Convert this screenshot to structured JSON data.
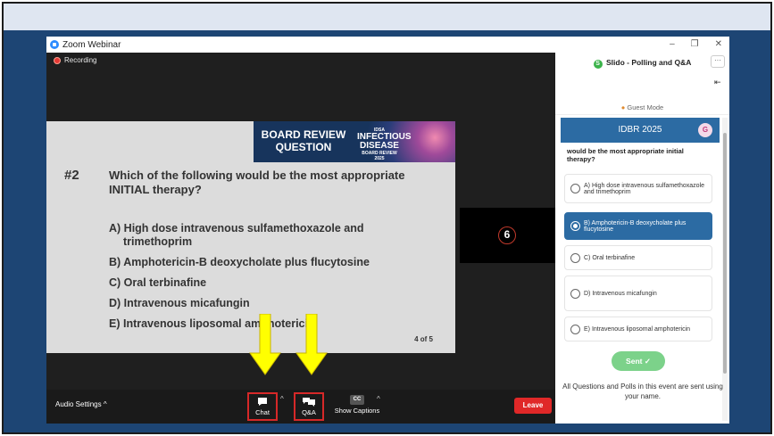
{
  "zoom": {
    "window_title": "Zoom Webinar",
    "recording_label": "Recording",
    "participant_count": "6"
  },
  "slide": {
    "header_title_line1": "BOARD REVIEW",
    "header_title_line2": "QUESTION",
    "logo_line1": "IDSA",
    "logo_line2a": "INFECTIOUS",
    "logo_line2b": "DISEASE",
    "logo_line3": "BOARD REVIEW",
    "logo_year": "2025",
    "question_number": "#2",
    "question_text": "Which of the following would be the most appropriate INITIAL therapy?",
    "options": [
      {
        "line1": "A) High dose intravenous sulfamethoxazole and",
        "line2": "trimethoprim"
      },
      {
        "line1": "B) Amphotericin-B deoxycholate plus flucytosine",
        "line2": ""
      },
      {
        "line1": "C) Oral terbinafine",
        "line2": ""
      },
      {
        "line1": "D) Intravenous micafungin",
        "line2": ""
      },
      {
        "line1": "E) Intravenous liposomal amphotericin",
        "line2": ""
      }
    ],
    "page_indicator": "4 of 5"
  },
  "toolbar": {
    "audio_settings_label": "Audio Settings",
    "chat_label": "Chat",
    "qa_label": "Q&A",
    "captions_label": "Show Captions",
    "cc_text": "CC",
    "leave_label": "Leave"
  },
  "slido": {
    "header_title": "Slido - Polling and Q&A",
    "more_label": "···",
    "guest_mode_label": "Guest Mode",
    "event_name": "IDBR 2025",
    "avatar_initial": "G",
    "question_partial": "would be the most appropriate initial therapy?",
    "options": [
      {
        "label": "A) High dose intravenous sulfamethoxazole and trimethoprim",
        "selected": false
      },
      {
        "label": "B) Amphotericin-B deoxycholate plus flucytosine",
        "selected": true
      },
      {
        "label": "C) Oral terbinafine",
        "selected": false
      },
      {
        "label": "D) Intravenous micafungin",
        "selected": false
      },
      {
        "label": "E) Intravenous liposomal amphotericin",
        "selected": false
      }
    ],
    "sent_label": "Sent ✓",
    "footer_note": "All Questions and Polls in this event are sent using your name."
  },
  "colors": {
    "arrow": "#ffff00",
    "highlight_box": "#d62828",
    "slido_blue": "#2c6ba3",
    "sent_green": "#7cd28a",
    "leave_red": "#e02828"
  }
}
